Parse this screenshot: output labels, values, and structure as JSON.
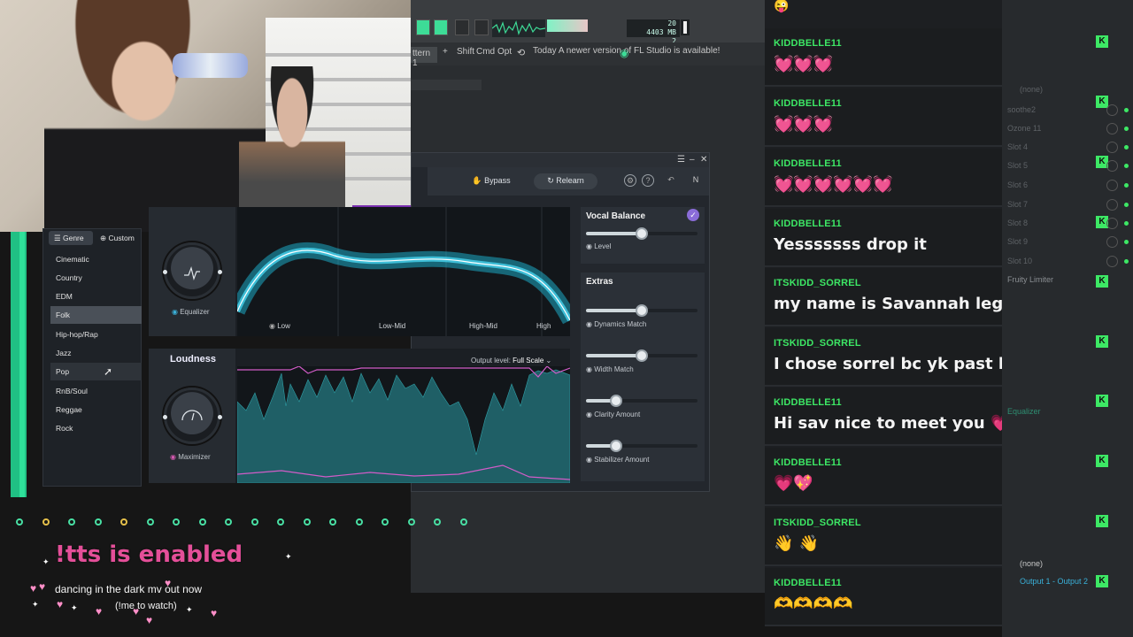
{
  "fl": {
    "readout_mem": "4403 MB",
    "readout_top": "20",
    "readout_bot": "2",
    "pattern": "ttern 1",
    "plus": "+",
    "shift": "Shift",
    "cmd": "Cmd",
    "opt": "Opt",
    "news": "Today  A newer version of FL Studio is available!"
  },
  "nectar": {
    "bypass": "Bypass",
    "relearn": "Relearn",
    "genre_tab": "Genre",
    "custom_tab": "Custom",
    "genres": [
      "Cinematic",
      "Country",
      "EDM",
      "Folk",
      "Hip-hop/Rap",
      "Jazz",
      "Pop",
      "RnB/Soul",
      "Reggae",
      "Rock"
    ],
    "selected_genre": "Folk",
    "equalizer_label": "Equalizer",
    "bands": [
      "Low",
      "Low-Mid",
      "High-Mid",
      "High"
    ],
    "loudness_title": "Loudness",
    "output_level_label": "Output level:",
    "output_level_value": "Full Scale",
    "maximizer_label": "Maximizer",
    "vocal_balance": {
      "title": "Vocal Balance",
      "level_label": "Level",
      "level": 0.5
    },
    "extras": {
      "title": "Extras",
      "sliders": [
        {
          "label": "Dynamics Match",
          "value": 0.5
        },
        {
          "label": "Width Match",
          "value": 0.5
        },
        {
          "label": "Clarity Amount",
          "value": 0.27
        },
        {
          "label": "Stabilizer Amount",
          "value": 0.27
        }
      ]
    }
  },
  "overlay": {
    "tts": "!tts is enabled",
    "now": "dancing in the dark mv out now",
    "watch": "(!me to watch)"
  },
  "chat": [
    {
      "user": "KIDDBELLE11",
      "text": "💓💓💓"
    },
    {
      "user": "KIDDBELLE11",
      "text": "💓💓💓"
    },
    {
      "user": "KIDDBELLE11",
      "text": "💓💓💓💓💓💓"
    },
    {
      "user": "KIDDBELLE11",
      "text": "Yesssssss drop it"
    },
    {
      "user": "ITSKIDD_SORREL",
      "text": "my name is Savannah legally 😭😭😭"
    },
    {
      "user": "ITSKIDD_SORREL",
      "text": "I chose sorrel bc yk past bs"
    },
    {
      "user": "KIDDBELLE11",
      "text": "Hi sav nice to meet you 💗"
    },
    {
      "user": "KIDDBELLE11",
      "text": "💗💖"
    },
    {
      "user": "ITSKIDD_SORREL",
      "text": "👋 👋"
    },
    {
      "user": "KIDDBELLE11",
      "text": "🫶🫶🫶🫶"
    }
  ],
  "k_badge": "K",
  "mixer_panel": {
    "none_label": "(none)",
    "slots": [
      "soothe2",
      "Ozone 11",
      "Slot 4",
      "Slot 5",
      "Slot 6",
      "Slot 7",
      "Slot 8",
      "Slot 9",
      "Slot 10"
    ],
    "fruity": "Fruity Limiter",
    "equalizer": "Equalizer",
    "none_bottom": "(none)",
    "output": "Output 1 - Output 2"
  }
}
